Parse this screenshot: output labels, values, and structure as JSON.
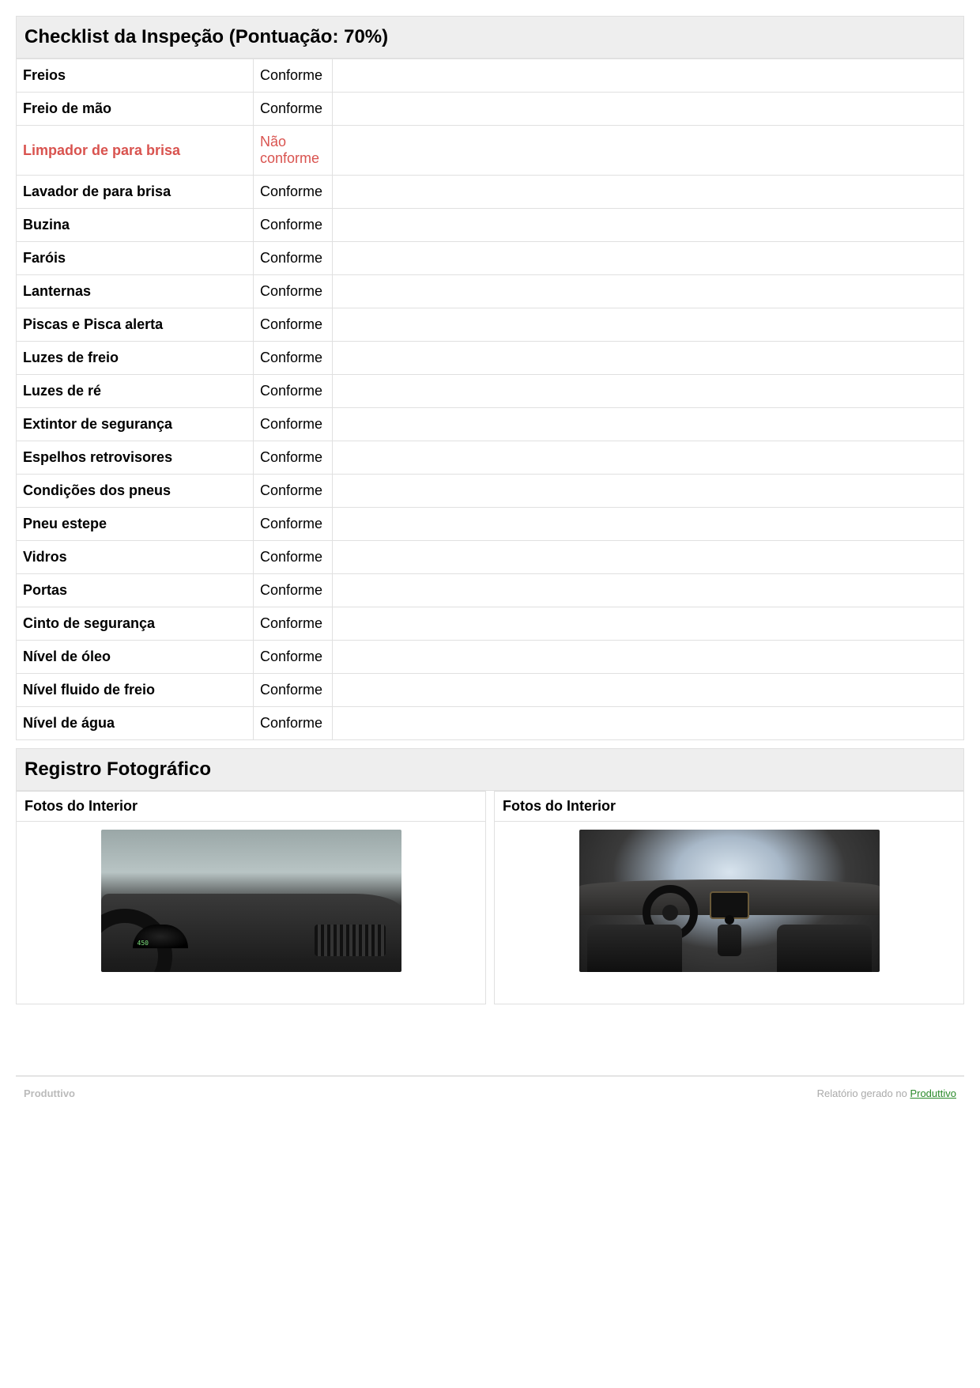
{
  "checklist": {
    "header": "Checklist da Inspeção (Pontuação: 70%)",
    "items": [
      {
        "name": "Freios",
        "status": "Conforme",
        "ok": true
      },
      {
        "name": "Freio de mão",
        "status": "Conforme",
        "ok": true
      },
      {
        "name": "Limpador de para brisa",
        "status": "Não conforme",
        "ok": false
      },
      {
        "name": "Lavador de para brisa",
        "status": "Conforme",
        "ok": true
      },
      {
        "name": "Buzina",
        "status": "Conforme",
        "ok": true
      },
      {
        "name": "Faróis",
        "status": "Conforme",
        "ok": true
      },
      {
        "name": "Lanternas",
        "status": "Conforme",
        "ok": true
      },
      {
        "name": "Piscas e Pisca alerta",
        "status": "Conforme",
        "ok": true
      },
      {
        "name": "Luzes de freio",
        "status": "Conforme",
        "ok": true
      },
      {
        "name": "Luzes de ré",
        "status": "Conforme",
        "ok": true
      },
      {
        "name": "Extintor de segurança",
        "status": "Conforme",
        "ok": true
      },
      {
        "name": "Espelhos retrovisores",
        "status": "Conforme",
        "ok": true
      },
      {
        "name": "Condições dos pneus",
        "status": "Conforme",
        "ok": true
      },
      {
        "name": "Pneu estepe",
        "status": "Conforme",
        "ok": true
      },
      {
        "name": "Vidros",
        "status": "Conforme",
        "ok": true
      },
      {
        "name": "Portas",
        "status": "Conforme",
        "ok": true
      },
      {
        "name": "Cinto de segurança",
        "status": "Conforme",
        "ok": true
      },
      {
        "name": "Nível de óleo",
        "status": "Conforme",
        "ok": true
      },
      {
        "name": "Nível fluido de freio",
        "status": "Conforme",
        "ok": true
      },
      {
        "name": "Nível de água",
        "status": "Conforme",
        "ok": true
      }
    ]
  },
  "photos": {
    "header": "Registro Fotográfico",
    "cells": [
      {
        "title": "Fotos do Interior"
      },
      {
        "title": "Fotos do Interior"
      }
    ]
  },
  "footer": {
    "brand": "Produttivo",
    "generated_prefix": "Relatório gerado no ",
    "generated_link": "Produttivo"
  }
}
